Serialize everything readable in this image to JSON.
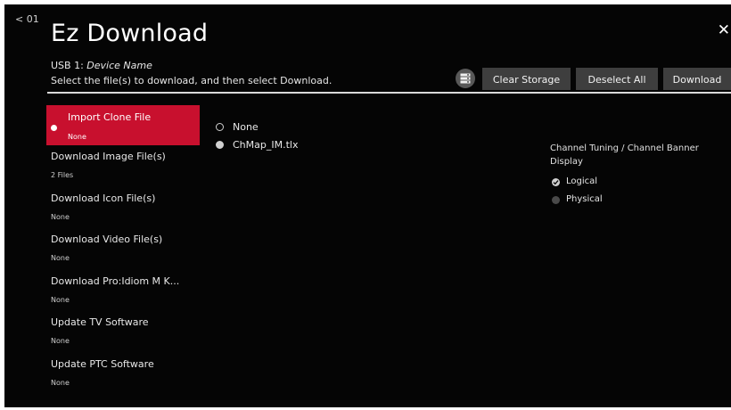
{
  "header": {
    "back_label": "< 01",
    "title": "Ez Download",
    "close_label": "✕",
    "device_prefix": "USB 1: ",
    "device_name": "Device Name",
    "instruction": "Select the file(s) to download, and then select Download."
  },
  "toolbar": {
    "storage_icon": "storage-icon",
    "clear_storage": "Clear Storage",
    "deselect_all": "Deselect All",
    "download": "Download"
  },
  "menu": {
    "items": [
      {
        "label": "Import Clone File",
        "sub": "None",
        "active": true
      },
      {
        "label": "Download Image File(s)",
        "sub": "2 Files"
      },
      {
        "label": "Download Icon File(s)",
        "sub": "None"
      },
      {
        "label": "Download Video File(s)",
        "sub": "None"
      },
      {
        "label": "Download Pro:Idiom M K...",
        "sub": "None"
      },
      {
        "label": "Update TV Software",
        "sub": "None"
      },
      {
        "label": "Update PTC Software",
        "sub": "None"
      }
    ]
  },
  "files": {
    "options": [
      {
        "label": "None",
        "selected": false
      },
      {
        "label": "ChMap_IM.tlx",
        "selected": true
      }
    ]
  },
  "channel_tuning": {
    "title": "Channel Tuning / Channel Banner Display",
    "options": [
      {
        "label": "Logical",
        "checked": true
      },
      {
        "label": "Physical",
        "checked": false
      }
    ]
  },
  "colors": {
    "accent": "#c8102e",
    "background": "#050505",
    "button": "#3e3e3e"
  }
}
